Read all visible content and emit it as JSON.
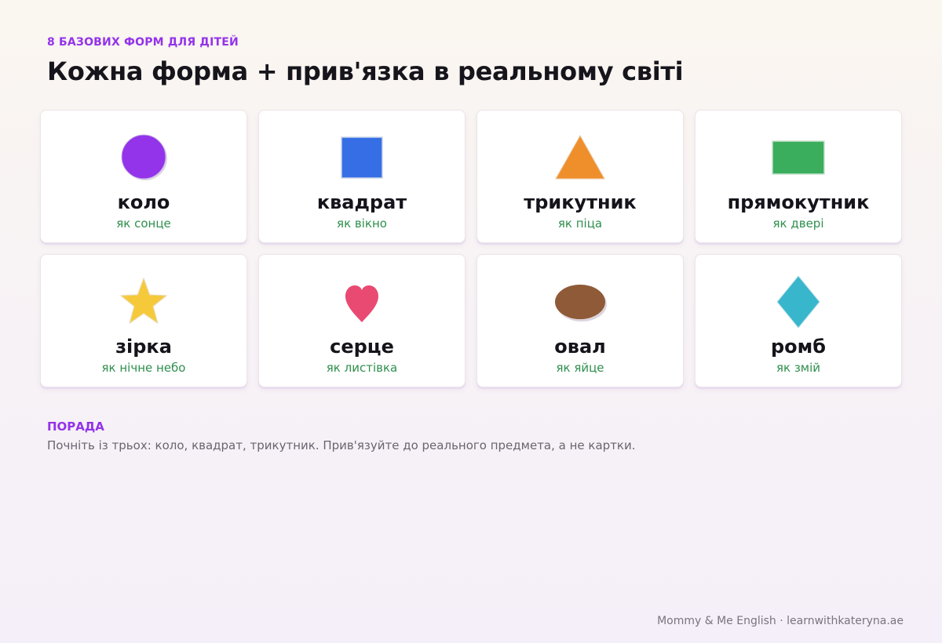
{
  "header": {
    "eyebrow": "8 БАЗОВИХ ФОРМ ДЛЯ ДІТЕЙ",
    "title": "Кожна форма + прив'язка в реальному світі"
  },
  "shapes": [
    {
      "name": "коло",
      "example": "як сонце",
      "icon": "circle-icon",
      "color": "#9333ea"
    },
    {
      "name": "квадрат",
      "example": "як вікно",
      "icon": "square-icon",
      "color": "#356ee5"
    },
    {
      "name": "трикутник",
      "example": "як піца",
      "icon": "triangle-icon",
      "color": "#ef8f2c"
    },
    {
      "name": "прямокутник",
      "example": "як двері",
      "icon": "rectangle-icon",
      "color": "#3aae5c"
    },
    {
      "name": "зірка",
      "example": "як нічне небо",
      "icon": "star-icon",
      "color": "#f5c93a"
    },
    {
      "name": "серце",
      "example": "як листівка",
      "icon": "heart-icon",
      "color": "#e94a72"
    },
    {
      "name": "овал",
      "example": "як яйце",
      "icon": "oval-icon",
      "color": "#8f5a37"
    },
    {
      "name": "ромб",
      "example": "як змій",
      "icon": "diamond-icon",
      "color": "#38b6cc"
    }
  ],
  "tip": {
    "label": "ПОРАДА",
    "text": "Почніть із трьох: коло, квадрат, трикутник. Прив'язуйте до реального предмета, а не картки."
  },
  "footer": {
    "text": "Mommy & Me English · learnwithkateryna.ae"
  },
  "colors": {
    "accent": "#9333ea",
    "example_text": "#2f8f4e"
  }
}
